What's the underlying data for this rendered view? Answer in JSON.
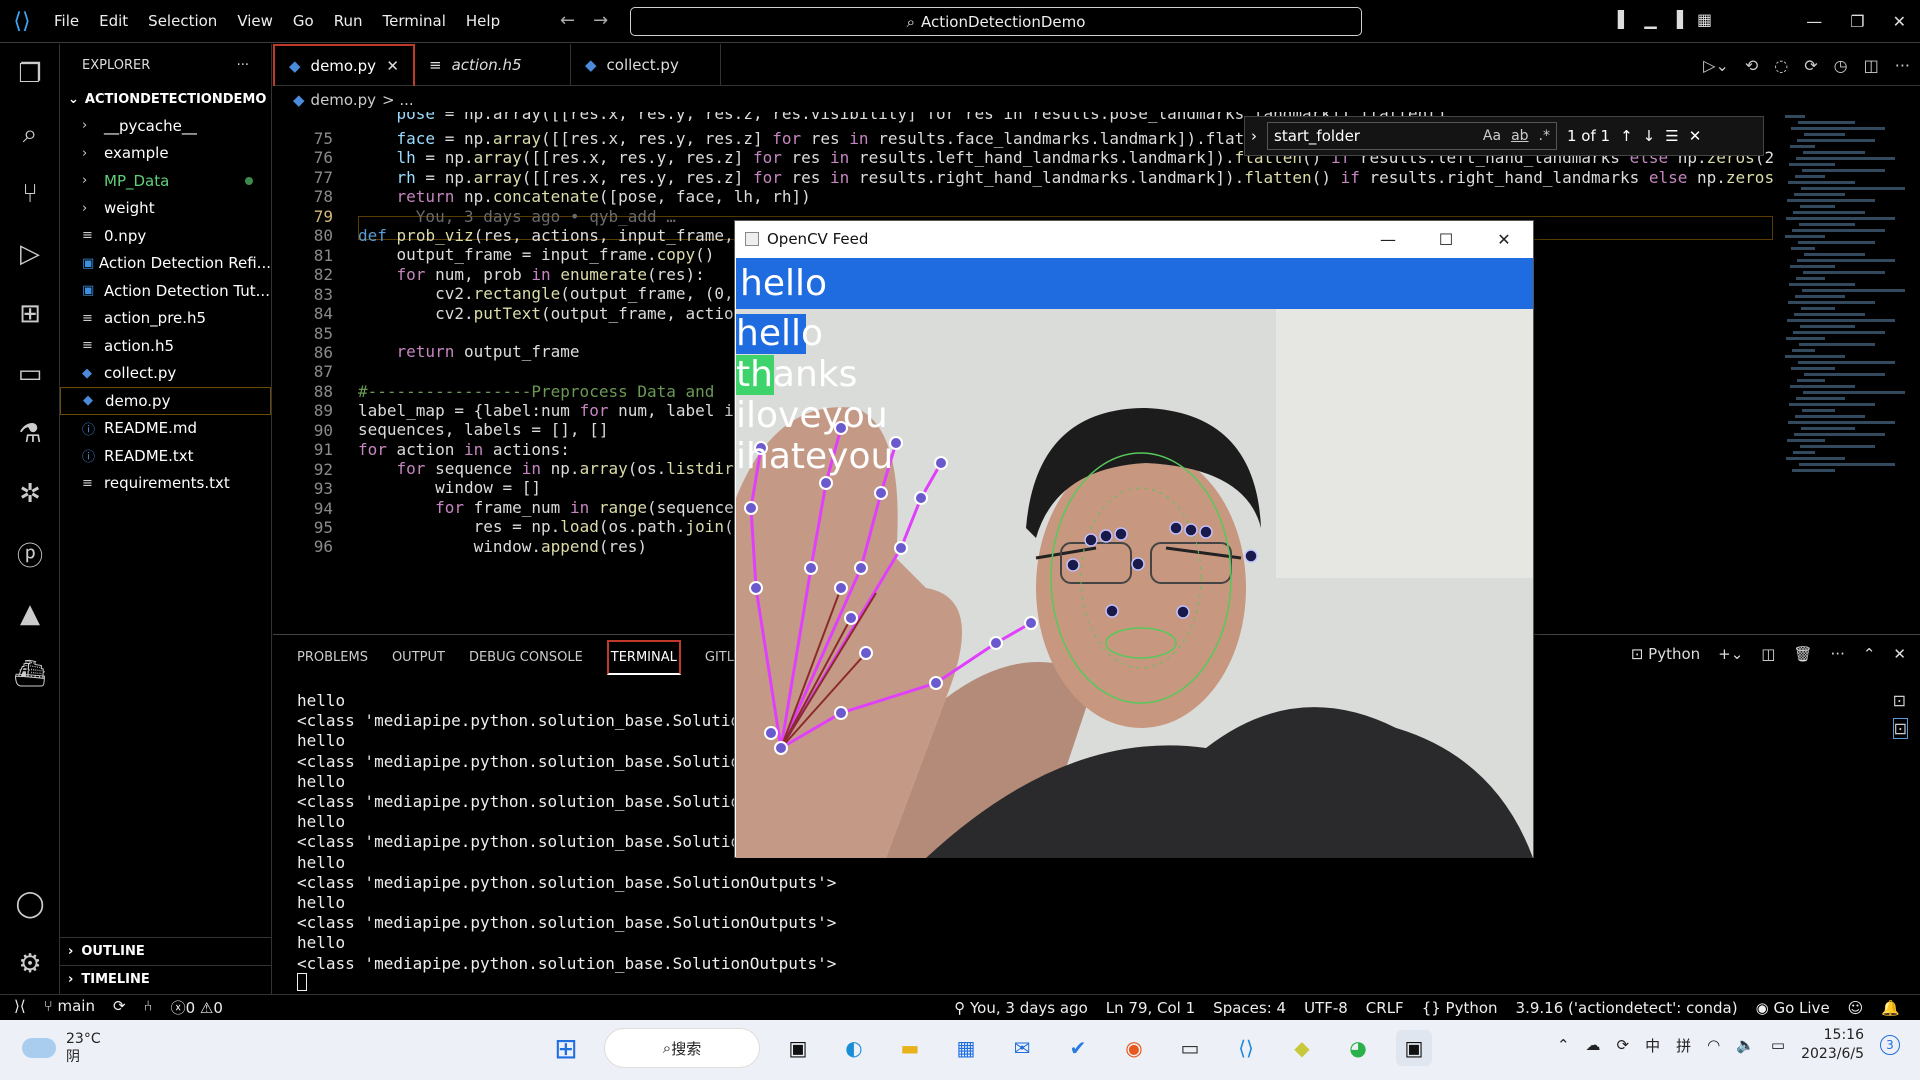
{
  "menu": [
    "File",
    "Edit",
    "Selection",
    "View",
    "Go",
    "Run",
    "Terminal",
    "Help"
  ],
  "title": "ActionDetectionDemo",
  "sidebar": {
    "header": "EXPLORER",
    "project": "ACTIONDETECTIONDEMO",
    "items": [
      {
        "label": "__pycache__",
        "glyph": "›"
      },
      {
        "label": "example",
        "glyph": "›"
      },
      {
        "label": "MP_Data",
        "glyph": "›"
      },
      {
        "label": "weight",
        "glyph": "›"
      },
      {
        "label": "0.npy",
        "glyph": "≡"
      },
      {
        "label": "Action Detection Refi...",
        "glyph": "▣"
      },
      {
        "label": "Action Detection Tut...",
        "glyph": "▣"
      },
      {
        "label": "action_pre.h5",
        "glyph": "≡"
      },
      {
        "label": "action.h5",
        "glyph": "≡"
      },
      {
        "label": "collect.py",
        "glyph": "◆"
      },
      {
        "label": "demo.py",
        "glyph": "◆"
      },
      {
        "label": "README.md",
        "glyph": "ⓘ"
      },
      {
        "label": "README.txt",
        "glyph": "ⓘ"
      },
      {
        "label": "requirements.txt",
        "glyph": "≡"
      }
    ],
    "outline": "OUTLINE",
    "timeline": "TIMELINE"
  },
  "tabs": [
    {
      "label": "demo.py",
      "glyph": "◆"
    },
    {
      "label": "action.h5",
      "glyph": "≡"
    },
    {
      "label": "collect.py",
      "glyph": "◆"
    }
  ],
  "breadcrumb": {
    "file": "demo.py",
    "rest": "> ..."
  },
  "find": {
    "query": "start_folder",
    "count": "1 of 1",
    "case": "Aa",
    "word": "ab",
    "regex": ".*"
  },
  "code": {
    "lines": [
      "75",
      "76",
      "77",
      "78",
      "79",
      "80",
      "81",
      "82",
      "83",
      "84",
      "85",
      "86",
      "87",
      "88",
      "89",
      "90",
      "91",
      "92",
      "93",
      "94",
      "95",
      "96"
    ]
  },
  "panel": {
    "tabs": [
      "PROBLEMS",
      "OUTPUT",
      "DEBUG CONSOLE",
      "TERMINAL",
      "GITL"
    ],
    "shell": "Python",
    "terminal": [
      "hello",
      "<class 'mediapipe.python.solution_base.SolutionOu",
      "hello",
      "<class 'mediapipe.python.solution_base.SolutionOu",
      "hello",
      "<class 'mediapipe.python.solution_base.SolutionOu",
      "hello",
      "<class 'mediapipe.python.solution_base.SolutionOu",
      "hello",
      "<class 'mediapipe.python.solution_base.SolutionOutputs'>",
      "hello",
      "<class 'mediapipe.python.solution_base.SolutionOutputs'>",
      "hello",
      "<class 'mediapipe.python.solution_base.SolutionOutputs'>"
    ]
  },
  "opencv": {
    "title": "OpenCV Feed",
    "banner": "hello",
    "labels": [
      "hello",
      "thanks",
      "iloveyou",
      "ihateyou"
    ]
  },
  "status": {
    "branch": "main",
    "errors": "0",
    "warnings": "0",
    "blame": "You, 3 days ago",
    "position": "Ln 79, Col 1",
    "spaces": "Spaces: 4",
    "encoding": "UTF-8",
    "eol": "CRLF",
    "language": "Python",
    "interpreter": "3.9.16 ('actiondetect': conda)",
    "golive": "Go Live"
  },
  "taskbar": {
    "temp": "23°C",
    "weather": "阴",
    "search": "搜索",
    "ime1": "中",
    "ime2": "拼",
    "time": "15:16",
    "date": "2023/6/5",
    "badge": "3"
  }
}
